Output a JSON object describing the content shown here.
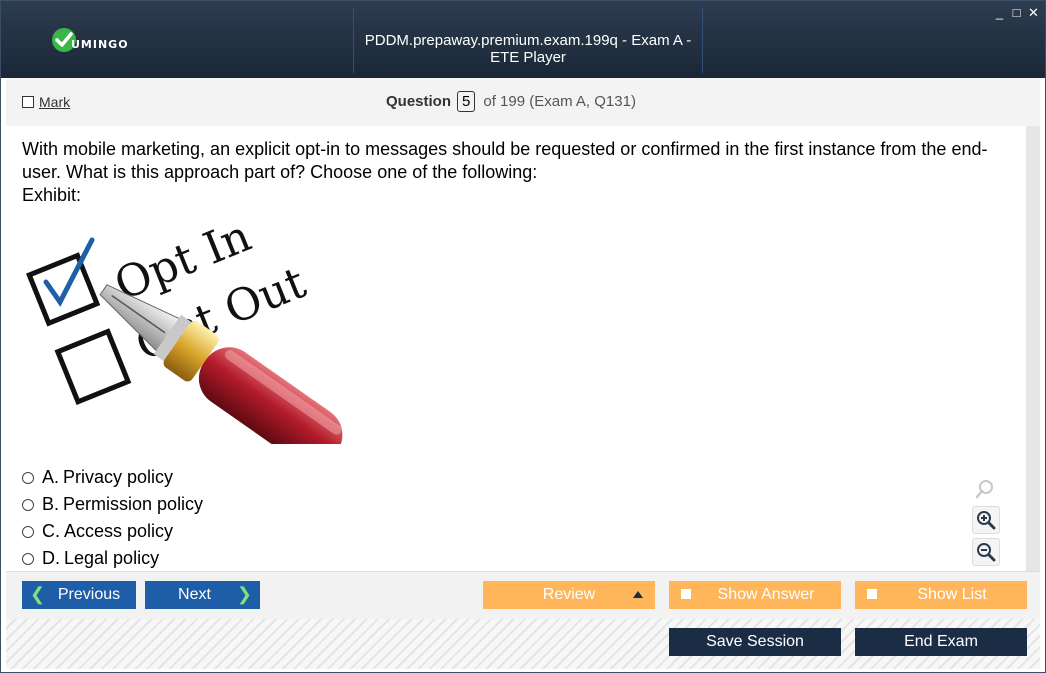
{
  "window": {
    "title": "PDDM.prepaway.premium.exam.199q - Exam A - ETE Player",
    "logo_text": "UMINGO",
    "controls": {
      "minimize": "_",
      "maximize": "□",
      "close": "✕"
    }
  },
  "question_bar": {
    "mark_label": "Mark",
    "question_label": "Question",
    "current": "5",
    "of_text": "of 199 (Exam A, Q131)"
  },
  "question": {
    "text": "With mobile marketing, an explicit opt-in to messages should be requested or confirmed in the first instance from the end-user. What is this approach part of? Choose one of the following:",
    "exhibit_label": "Exhibit:",
    "exhibit_text": {
      "opt_in": "Opt In",
      "opt_out": "Opt Out"
    },
    "answers": [
      {
        "letter": "A.",
        "text": "Privacy policy"
      },
      {
        "letter": "B.",
        "text": "Permission policy"
      },
      {
        "letter": "C.",
        "text": "Access policy"
      },
      {
        "letter": "D.",
        "text": "Legal policy"
      }
    ]
  },
  "nav": {
    "previous": "Previous",
    "next": "Next",
    "review": "Review",
    "show_answer": "Show Answer",
    "show_list": "Show List",
    "save_session": "Save Session",
    "end_exam": "End Exam"
  },
  "colors": {
    "accent_blue": "#1e5ea8",
    "accent_orange": "#ffb55a",
    "dark_navy": "#1a2d45",
    "logo_green": "#3ab54a"
  }
}
